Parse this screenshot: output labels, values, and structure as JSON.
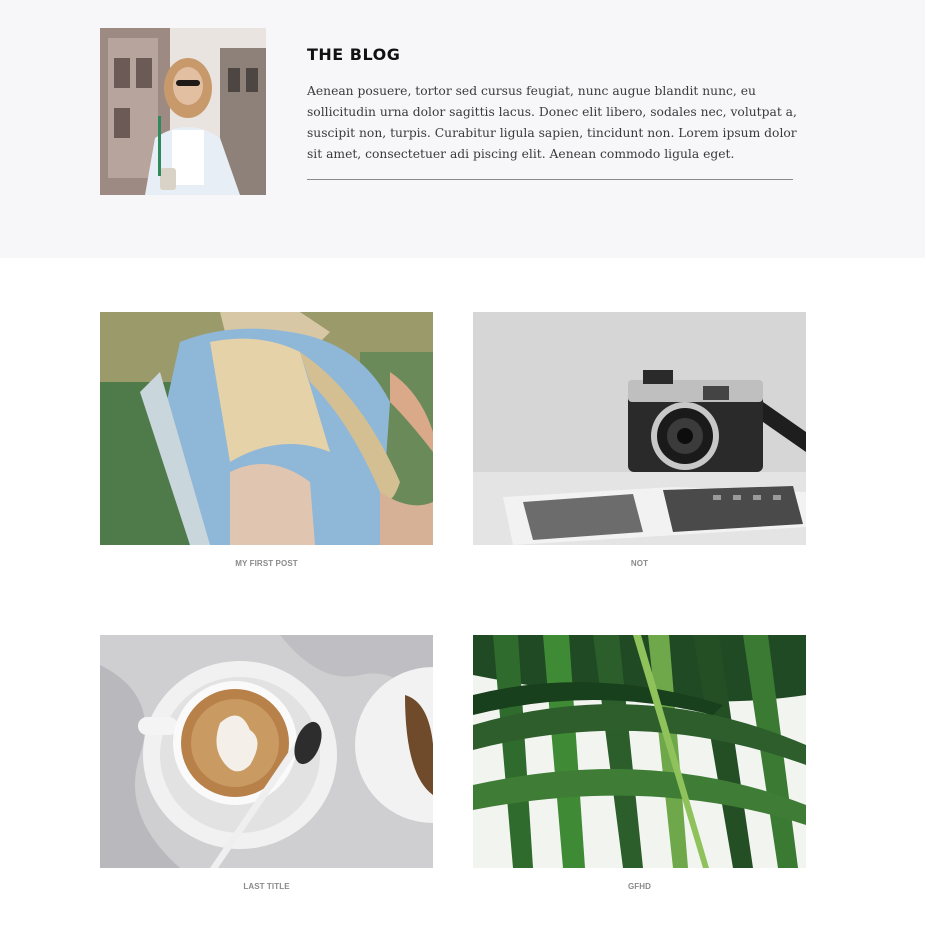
{
  "hero": {
    "title": "THE BLOG",
    "text": "Aenean posuere, tortor sed cursus feugiat, nunc augue blandit nunc, eu sollicitudin urna dolor sagittis lacus. Donec elit libero, sodales nec, volutpat a, suscipit non, turpis. Curabitur ligula sapien, tincidunt non. Lorem ipsum dolor sit amet, consectetuer adi piscing elit. Aenean commodo ligula eget.",
    "photo": "woman-with-sunglasses-photo"
  },
  "posts": [
    {
      "title": "MY FIRST POST",
      "image": "woman-on-chair-photo"
    },
    {
      "title": "NOT",
      "image": "camera-photo"
    },
    {
      "title": "LAST TITLE",
      "image": "latte-coffee-photo"
    },
    {
      "title": "GFHD",
      "image": "palm-leaves-photo"
    }
  ],
  "colors": {
    "hero_background": "#f7f7f9",
    "caption": "#8a8a8a",
    "rule": "#8a8a8a"
  }
}
